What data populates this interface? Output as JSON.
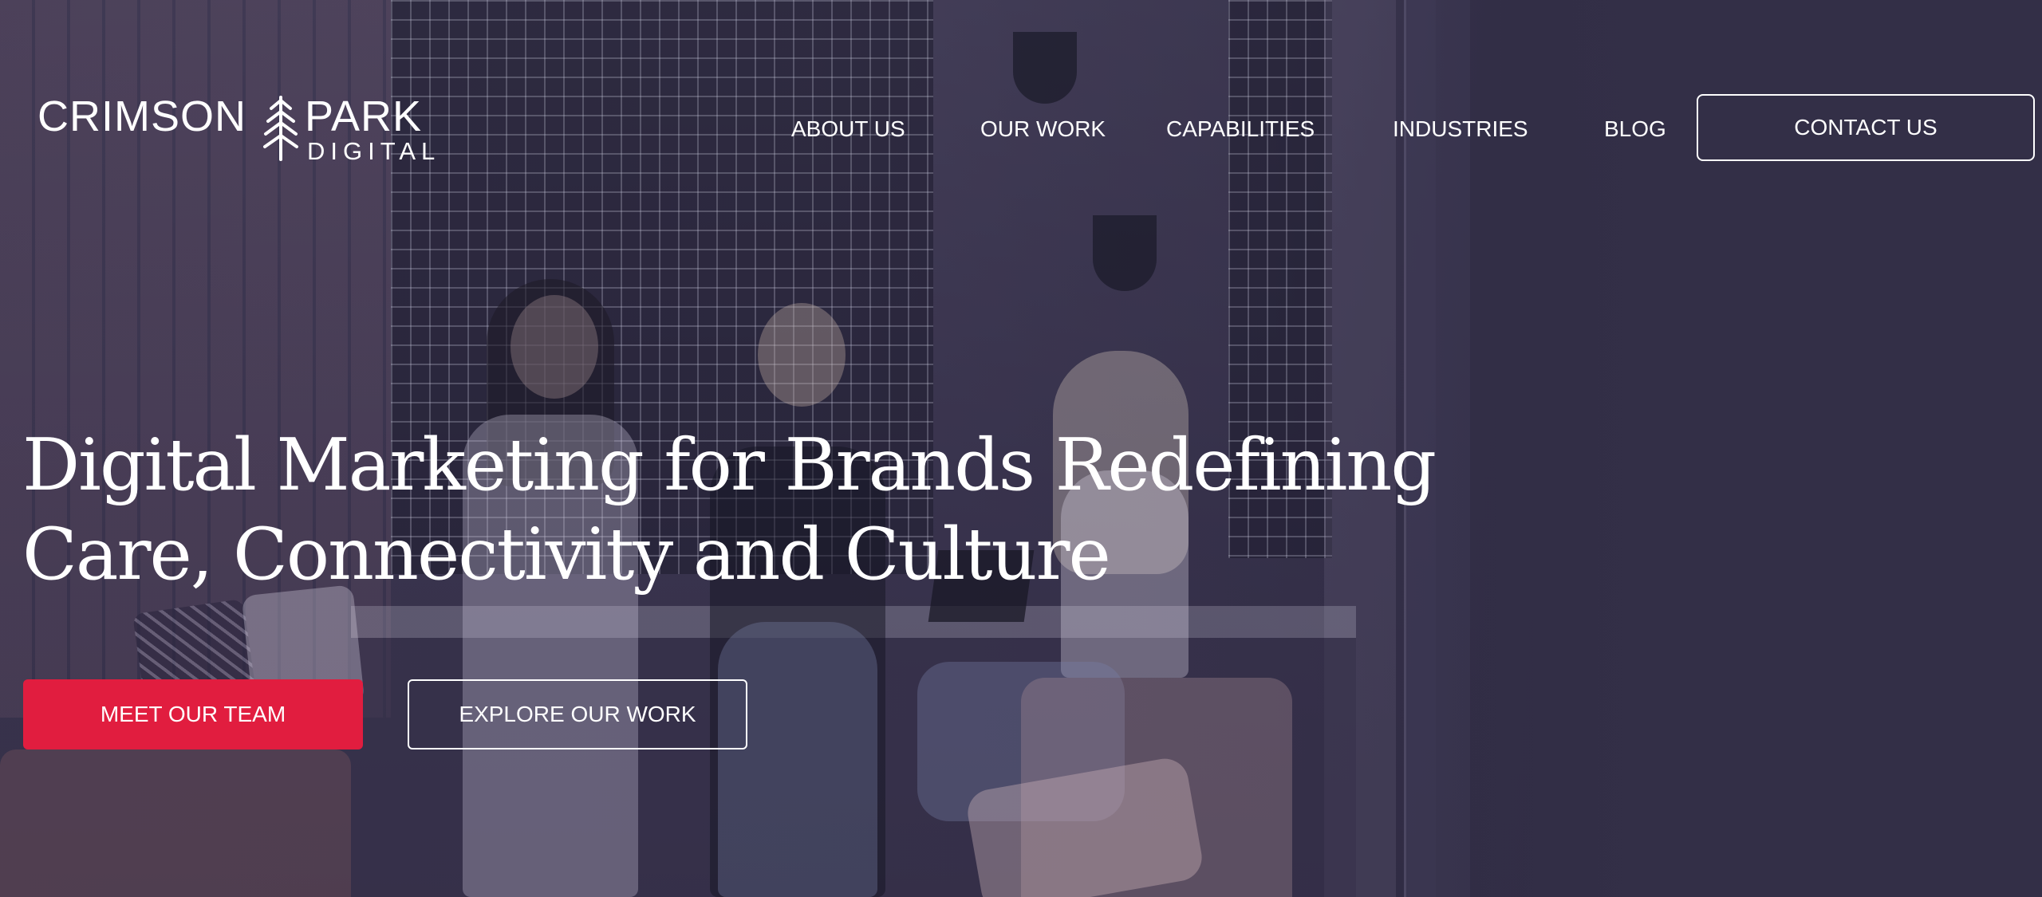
{
  "logo": {
    "word_left": "CRIMSON",
    "word_right": "PARK",
    "subline": "DIGITAL",
    "icon": "pine-tree-icon"
  },
  "nav": {
    "items": [
      {
        "label": "ABOUT US"
      },
      {
        "label": "OUR WORK"
      },
      {
        "label": "CAPABILITIES"
      },
      {
        "label": "INDUSTRIES"
      },
      {
        "label": "BLOG"
      }
    ],
    "contact_label": "CONTACT US"
  },
  "hero": {
    "headline_line1": "Digital Marketing for Brands Redefining",
    "headline_line2": "Care, Connectivity and Culture",
    "primary_cta": "MEET OUR TEAM",
    "secondary_cta": "EXPLORE OUR WORK"
  },
  "colors": {
    "accent": "#e11d3f",
    "overlay": "#332f47",
    "text": "#ffffff"
  }
}
